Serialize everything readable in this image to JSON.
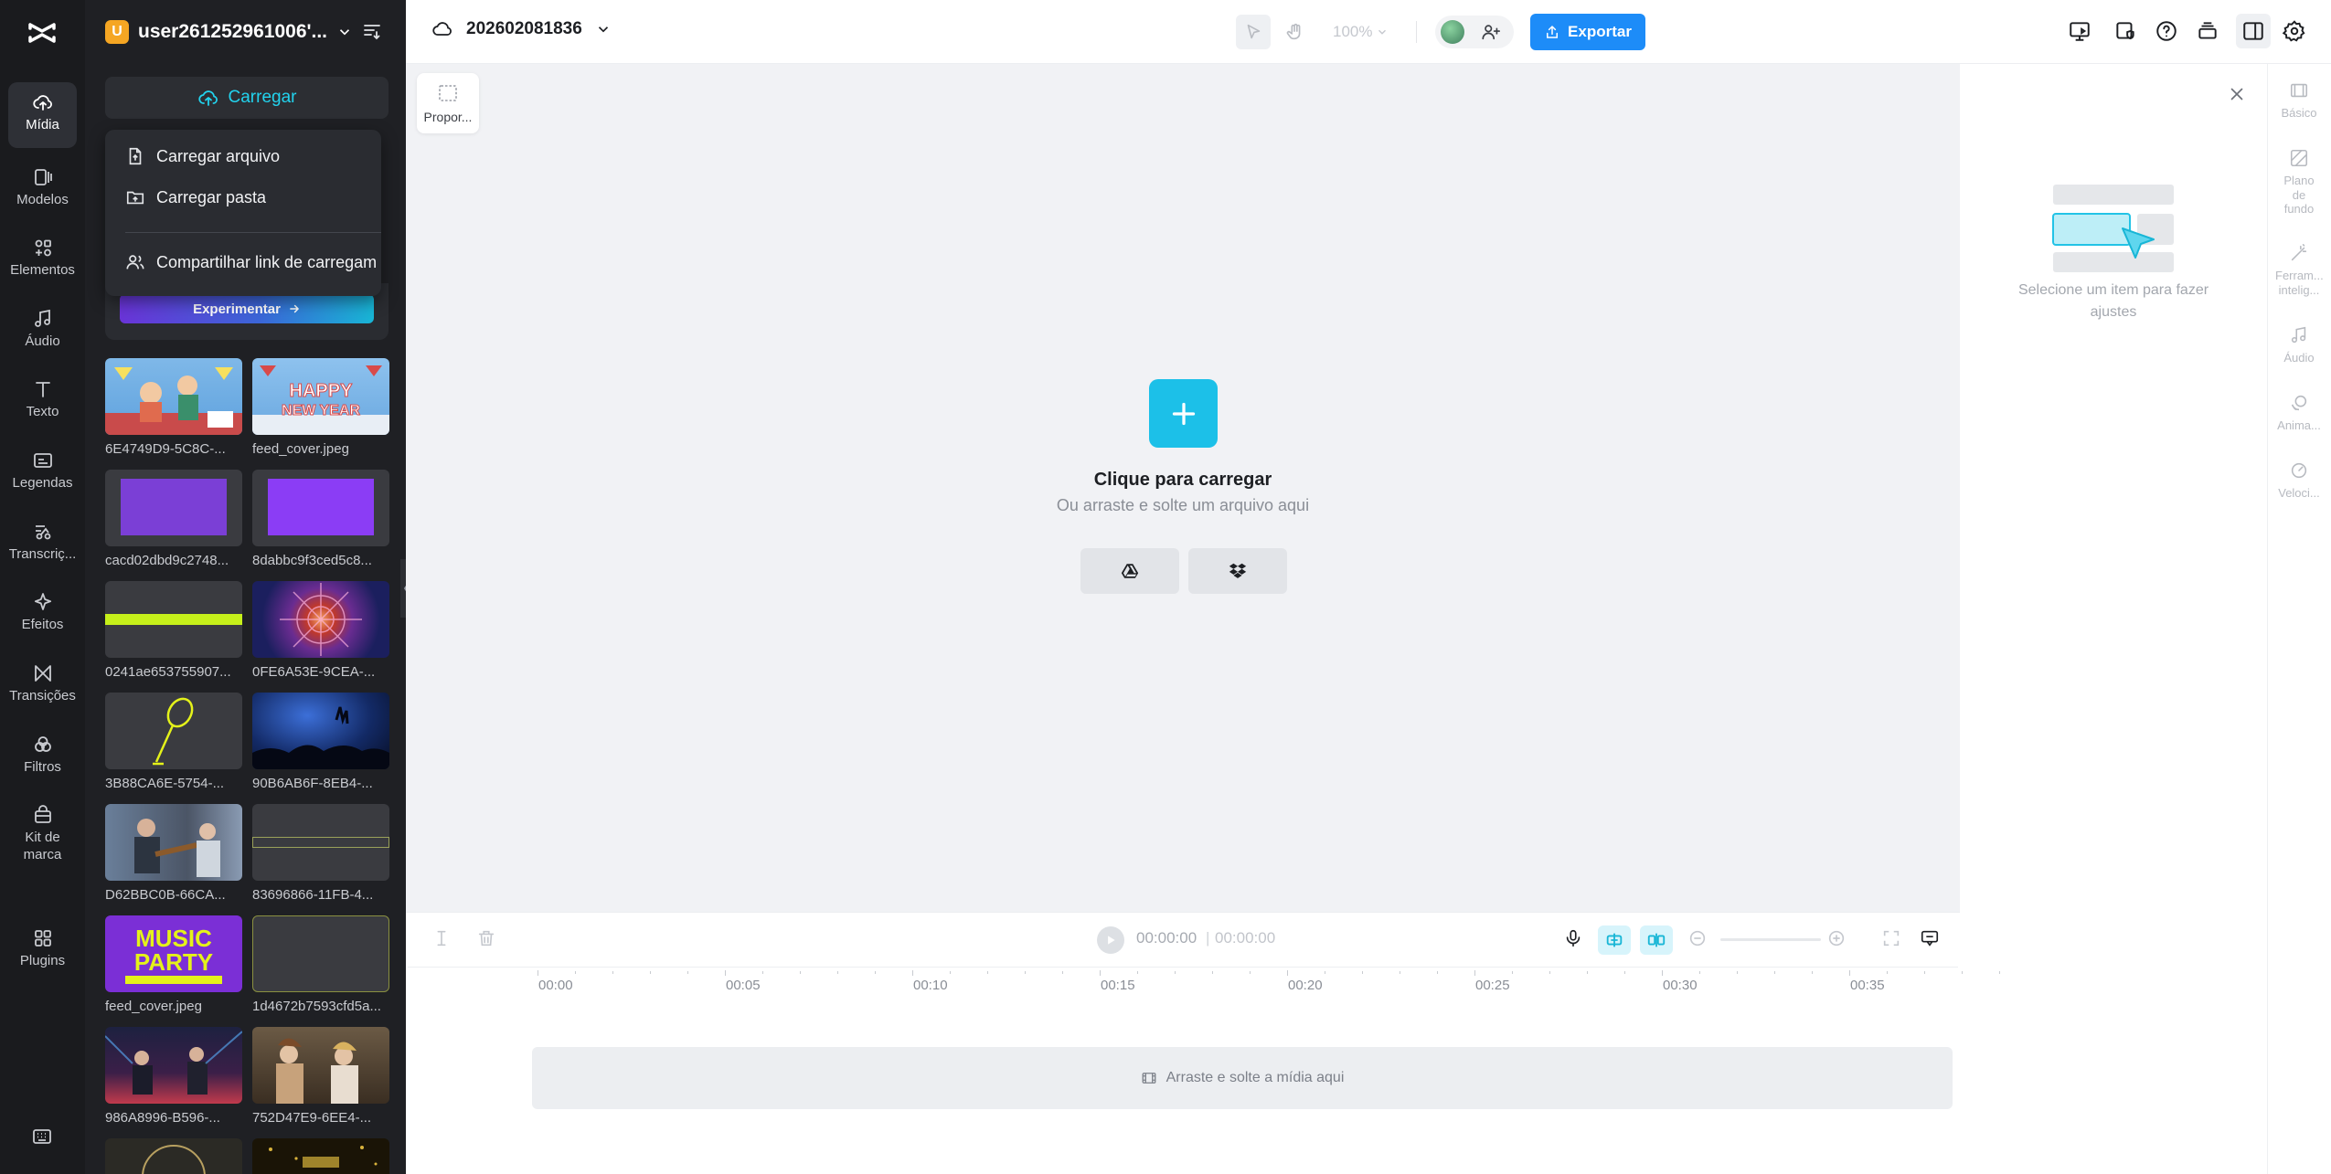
{
  "nav": {
    "items": [
      {
        "label": "Mídia",
        "icon": "cloud-upload-icon",
        "active": true
      },
      {
        "label": "Modelos",
        "icon": "templates-icon"
      },
      {
        "label": "Elementos",
        "icon": "elements-icon"
      },
      {
        "label": "Áudio",
        "icon": "music-note-icon"
      },
      {
        "label": "Texto",
        "icon": "text-icon"
      },
      {
        "label": "Legendas",
        "icon": "captions-icon"
      },
      {
        "label": "Transcriç...",
        "icon": "transcript-icon"
      },
      {
        "label": "Efeitos",
        "icon": "sparkle-icon"
      },
      {
        "label": "Transições",
        "icon": "transitions-icon"
      },
      {
        "label": "Filtros",
        "icon": "filters-icon"
      },
      {
        "label": "Kit de marca",
        "icon": "brand-kit-icon"
      },
      {
        "label": "Plugins",
        "icon": "plugins-icon"
      }
    ]
  },
  "panel": {
    "account_badge": "U",
    "account_name": "user261252961006'...",
    "upload_label": "Carregar",
    "menu": {
      "upload_file": "Carregar arquivo",
      "upload_folder": "Carregar pasta",
      "share_link": "Compartilhar link de carregam"
    },
    "try_label": "Experimentar",
    "media": [
      {
        "name": "6E4749D9-5C8C-...",
        "style": "illus-people"
      },
      {
        "name": "feed_cover.jpeg",
        "style": "illus-newyear"
      },
      {
        "name": "cacd02dbd9c2748...",
        "style": "purple-texture"
      },
      {
        "name": "8dabbc9f3ced5c8...",
        "style": "purple-solid"
      },
      {
        "name": "0241ae653755907...",
        "style": "green-bar"
      },
      {
        "name": "0FE6A53E-9CEA-...",
        "style": "kaleidoscope"
      },
      {
        "name": "3B88CA6E-5754-...",
        "style": "mic-yellow"
      },
      {
        "name": "90B6AB6F-8EB4-...",
        "style": "concert-blue"
      },
      {
        "name": "D62BBC0B-66CA...",
        "style": "guitar-photo"
      },
      {
        "name": "83696866-11FB-4...",
        "style": "dark-line"
      },
      {
        "name": "feed_cover.jpeg",
        "style": "music-party"
      },
      {
        "name": "1d4672b7593cfd5a...",
        "style": "dark-empty"
      },
      {
        "name": "986A8996-B596-...",
        "style": "band-stage"
      },
      {
        "name": "752D47E9-6EE4-...",
        "style": "party-crowd"
      },
      {
        "name": "",
        "style": "clock"
      },
      {
        "name": "",
        "style": "gold-party"
      }
    ]
  },
  "topbar": {
    "project_name": "202602081836",
    "zoom": "100%",
    "export_label": "Exportar",
    "brand_color": "#1d8cf8"
  },
  "canvas": {
    "ratio_label": "Propor...",
    "upload_title": "Clique para carregar",
    "upload_sub": "Ou arraste e solte um arquivo aqui",
    "accent": "#1cc0e8"
  },
  "props": {
    "empty_text": "Selecione um item para fazer ajustes",
    "tabs": [
      {
        "label": "Básico",
        "icon": "basic-icon"
      },
      {
        "label": "Plano de fundo",
        "icon": "background-icon"
      },
      {
        "label": "Ferram... intelig...",
        "icon": "smart-tools-icon"
      },
      {
        "label": "Áudio",
        "icon": "audio-icon"
      },
      {
        "label": "Anima...",
        "icon": "animation-icon"
      },
      {
        "label": "Veloci...",
        "icon": "speed-icon"
      }
    ]
  },
  "timeline": {
    "current_time": "00:00:00",
    "total_time": "00:00:00",
    "ticks": [
      "00:00",
      "00:05",
      "00:10",
      "00:15",
      "00:20",
      "00:25",
      "00:30",
      "00:35"
    ],
    "drop_text": "Arraste e solte a mídia aqui"
  }
}
